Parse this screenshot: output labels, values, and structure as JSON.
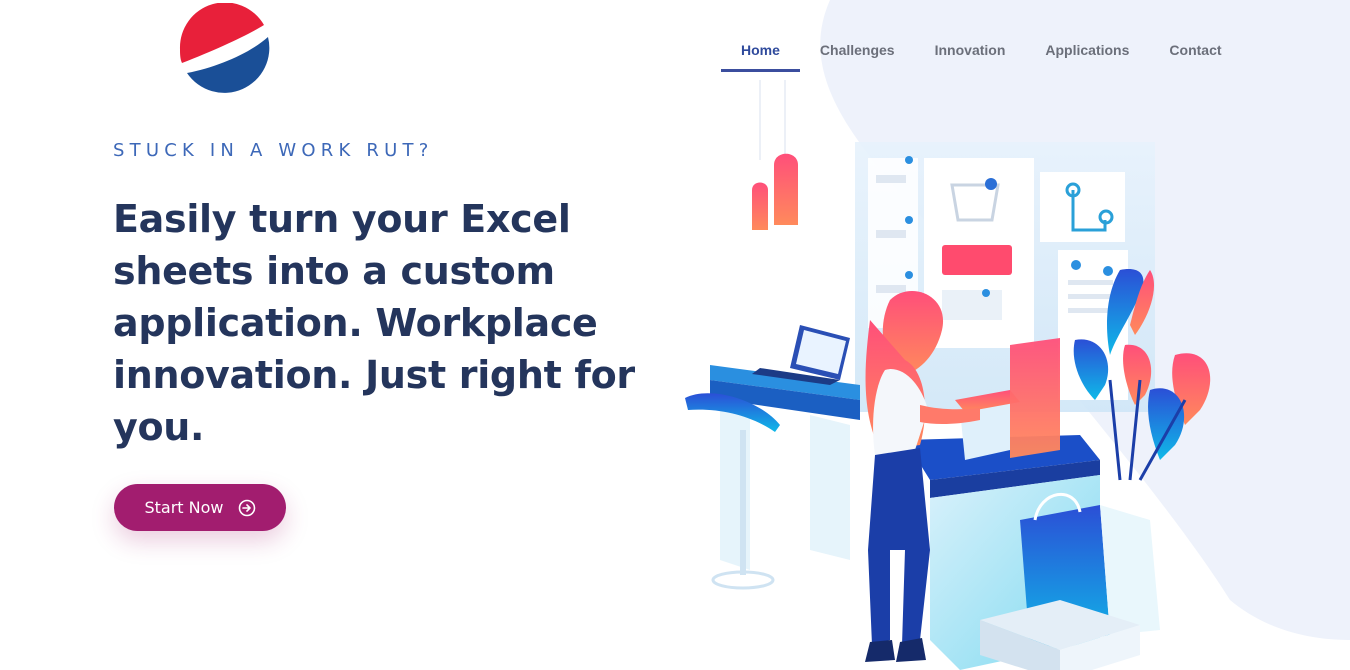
{
  "nav": {
    "items": [
      {
        "label": "Home",
        "active": true
      },
      {
        "label": "Challenges",
        "active": false
      },
      {
        "label": "Innovation",
        "active": false
      },
      {
        "label": "Applications",
        "active": false
      },
      {
        "label": "Contact",
        "active": false
      }
    ]
  },
  "hero": {
    "eyebrow": "STUCK IN A WORK RUT?",
    "headline": "Easily turn your Excel sheets into a custom application. Workplace innovation. Just right for you.",
    "cta_label": "Start Now",
    "cta_icon": "arrow-right-circle-icon"
  },
  "colors": {
    "accent": "#a21d6f",
    "headline": "#24355c",
    "eyebrow": "#3d68b8",
    "nav_active": "#2f4a9c",
    "nav_text": "#6b6f7a",
    "bg_shape": "#eef2fb",
    "logo_red": "#e8203a",
    "logo_blue": "#1a4f97"
  },
  "illustration": {
    "description_icon": "woman-shopping-dashboard-illustration"
  }
}
